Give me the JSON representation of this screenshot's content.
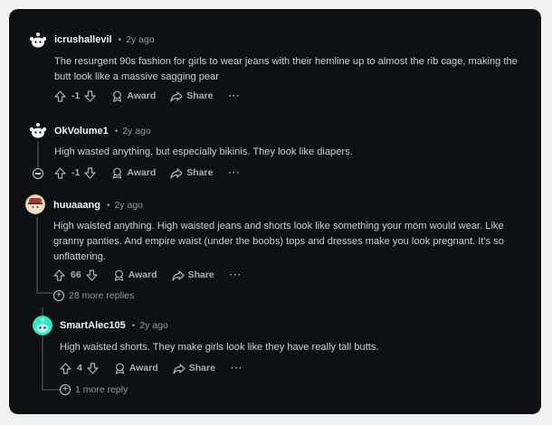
{
  "comments": [
    {
      "author": "icrushallevil",
      "time": "2y ago",
      "text": "The resurgent 90s fashion for girls to wear jeans with their hemline up to almost the rib cage, making the butt look like a massive sagging pear",
      "score": "-1",
      "award_label": "Award",
      "share_label": "Share",
      "more_label": "···",
      "avatar": "snoo-white-icon"
    },
    {
      "author": "OkVolume1",
      "time": "2y ago",
      "text": "High wasted anything, but especially bikinis. They look like diapers.",
      "score": "-1",
      "award_label": "Award",
      "share_label": "Share",
      "more_label": "···",
      "avatar": "snoo-white-icon"
    },
    {
      "author": "huuaaang",
      "time": "2y ago",
      "text": "High waisted anything. High waisted jeans and shorts look like something your mom would wear. Like granny panties. And empire waist (under the boobs) tops and dresses make you look pregnant. It's so unflattering.",
      "score": "66",
      "award_label": "Award",
      "share_label": "Share",
      "more_label": "···",
      "more_replies": "28 more replies",
      "avatar": "snoo-hat-icon"
    },
    {
      "author": "SmartAlec105",
      "time": "2y ago",
      "text": "High waisted shorts. They make girls look like they have really tall butts.",
      "score": "4",
      "award_label": "Award",
      "share_label": "Share",
      "more_label": "···",
      "more_replies": "1 more reply",
      "avatar": "snoo-teal-icon"
    }
  ],
  "colors": {
    "background": "#0e1113",
    "text": "#c7d1d8",
    "meta": "#8b9aa5",
    "thread_line": "#33393e"
  }
}
